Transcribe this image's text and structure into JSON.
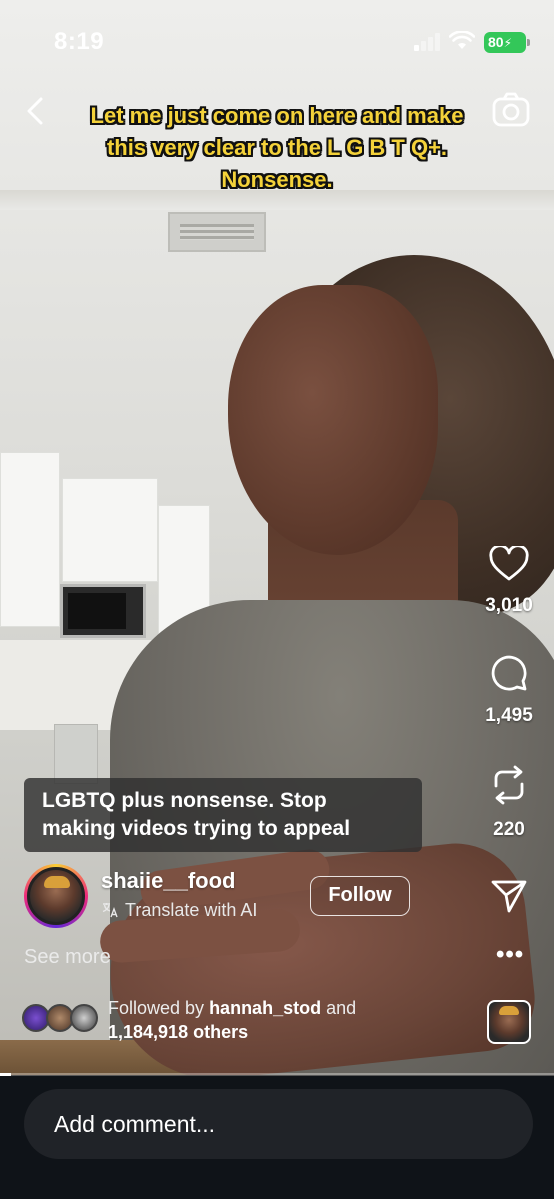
{
  "status_bar": {
    "time": "8:19",
    "battery": "80"
  },
  "video": {
    "caption": "Let me just come on here and make this very clear to the L G B T Q+. Nonsense.",
    "subtitle": "LGBTQ plus nonsense. Stop making videos trying to appeal",
    "progress": 0.02
  },
  "actions": {
    "likes": "3,010",
    "comments": "1,495",
    "reposts": "220"
  },
  "author": {
    "username": "shaiie__food",
    "translate_label": "Translate with AI",
    "follow_label": "Follow",
    "see_more_label": "See more"
  },
  "followed_by": {
    "prefix": "Followed by ",
    "name": "hannah_stod",
    "middle": " and",
    "others": "1,184,918 others"
  },
  "comment": {
    "placeholder": "Add comment..."
  },
  "colors": {
    "caption_yellow": "#f4d23a",
    "battery_green": "#33c759",
    "bottom_bar": "#0f1318"
  },
  "icons": [
    "back-icon",
    "camera-icon",
    "heart-icon",
    "comment-icon",
    "repost-icon",
    "share-icon",
    "more-icon",
    "translate-icon"
  ]
}
